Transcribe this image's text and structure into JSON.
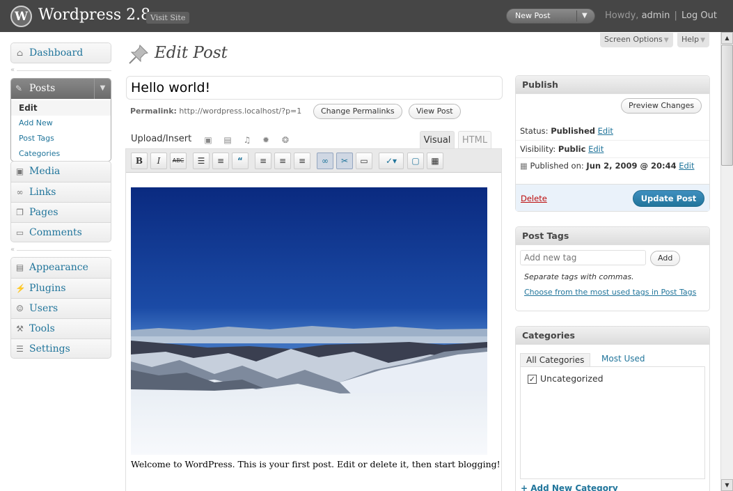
{
  "header": {
    "logo_letter": "W",
    "site_title": "Wordpress 2.8",
    "visit_site": "Visit Site",
    "new_post": "New Post",
    "howdy": "Howdy,",
    "user": "admin",
    "divider": "|",
    "logout": "Log Out"
  },
  "screen_options": "Screen Options",
  "help": "Help",
  "menu": {
    "dashboard": "Dashboard",
    "posts": "Posts",
    "posts_submenu": [
      "Edit",
      "Add New",
      "Post Tags",
      "Categories"
    ],
    "group2": [
      "Media",
      "Links",
      "Pages",
      "Comments"
    ],
    "group3": [
      "Appearance",
      "Plugins",
      "Users",
      "Tools",
      "Settings"
    ]
  },
  "page": {
    "title": "Edit Post",
    "post_title": "Hello world!",
    "permalink_label": "Permalink:",
    "permalink_url": "http://wordpress.localhost/?p=1",
    "change_permalinks": "Change Permalinks",
    "view_post": "View Post"
  },
  "editor": {
    "upload_insert": "Upload/Insert",
    "tab_visual": "Visual",
    "tab_html": "HTML",
    "toolbar": [
      "B",
      "I",
      "ABC"
    ],
    "content_text": "Welcome to WordPress. This is your first post. Edit or delete it, then start blogging!"
  },
  "publish": {
    "title": "Publish",
    "preview_changes": "Preview Changes",
    "status_label": "Status:",
    "status_value": "Published",
    "visibility_label": "Visibility:",
    "visibility_value": "Public",
    "published_on_label": "Published on:",
    "published_on_value": "Jun 2, 2009 @ 20:44",
    "edit": "Edit",
    "delete": "Delete",
    "update_post": "Update Post"
  },
  "post_tags": {
    "title": "Post Tags",
    "placeholder": "Add new tag",
    "add": "Add",
    "hint": "Separate tags with commas.",
    "choose_link": "Choose from the most used tags in Post Tags"
  },
  "categories": {
    "title": "Categories",
    "tab_all": "All Categories",
    "tab_most_used": "Most Used",
    "items": [
      "Uncategorized"
    ],
    "add_new": "+ Add New Category"
  },
  "colors": {
    "header_bg": "#464646",
    "link": "#21759b",
    "primary_button": "#21759b",
    "delete": "#bc0b0b"
  }
}
